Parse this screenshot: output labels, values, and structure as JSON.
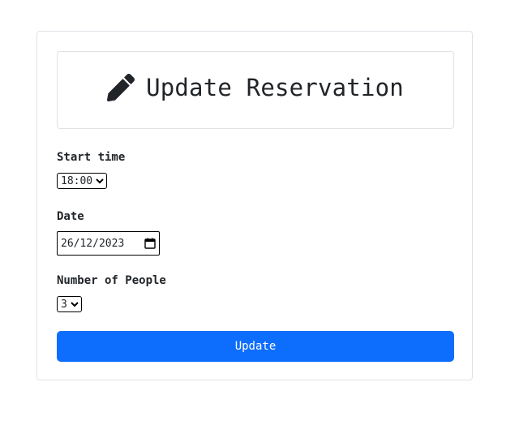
{
  "header": {
    "icon": "pencil-icon",
    "title": "Update Reservation"
  },
  "form": {
    "start_time": {
      "label": "Start time",
      "value": "18:00"
    },
    "date": {
      "label": "Date",
      "value": "26/12/2023"
    },
    "people": {
      "label": "Number of People",
      "value": "3"
    },
    "submit_label": "Update"
  },
  "colors": {
    "primary": "#0d6efd",
    "border": "#dee2e6",
    "text": "#212529"
  }
}
